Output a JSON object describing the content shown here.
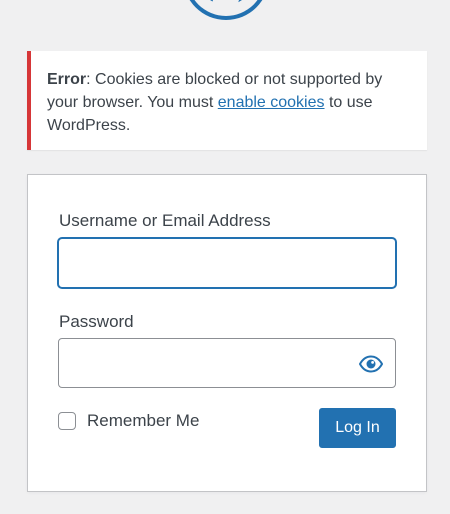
{
  "logo": {
    "icon": "wordpress-logo-icon",
    "color": "#2271b1"
  },
  "notice": {
    "label": "Error",
    "text_before": ": Cookies are blocked or not supported by your browser. You must ",
    "link_text": "enable cookies",
    "text_after": " to use WordPress.",
    "border_color": "#d63638"
  },
  "form": {
    "username_label": "Username or Email Address",
    "username_value": "",
    "password_label": "Password",
    "password_value": "",
    "show_password_icon": "eye-icon",
    "remember_label": "Remember Me",
    "remember_checked": false,
    "login_button": "Log In",
    "accent": "#2271b1"
  }
}
